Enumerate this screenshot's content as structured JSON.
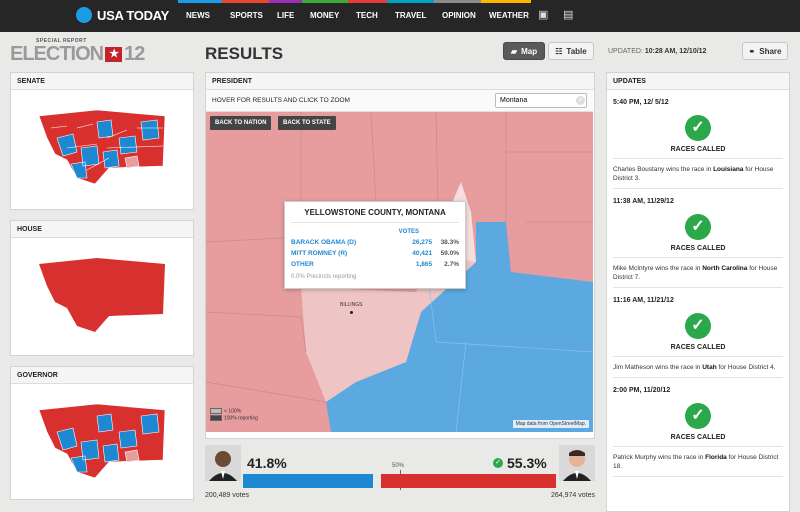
{
  "nav": {
    "logo": "USA TODAY",
    "items": [
      {
        "label": "NEWS",
        "color": "#1c9ce6"
      },
      {
        "label": "SPORTS",
        "color": "#e64a2e"
      },
      {
        "label": "LIFE",
        "color": "#9b2eb8"
      },
      {
        "label": "MONEY",
        "color": "#3cab3b"
      },
      {
        "label": "TECH",
        "color": "#e83a3a"
      },
      {
        "label": "TRAVEL",
        "color": "#00a3c4"
      },
      {
        "label": "OPINION",
        "color": "#8c8c8c"
      },
      {
        "label": "WEATHER",
        "color": "#ffb400"
      }
    ],
    "icons": [
      "media-icon",
      "weather-icon"
    ]
  },
  "header": {
    "special_report": "SPECIAL REPORT",
    "election": "ELECTION",
    "election_year": "12",
    "title": "RESULTS",
    "map_label": "Map",
    "table_label": "Table",
    "updated_label": "UPDATED:",
    "updated_value": "10:28 AM, 12/10/12",
    "share_label": "Share"
  },
  "left": {
    "senate": "SENATE",
    "house": "HOUSE",
    "governor": "GOVERNOR"
  },
  "president": {
    "title": "PRESIDENT",
    "hint": "HOVER FOR RESULTS AND CLICK TO ZOOM",
    "search_value": "Montana",
    "back_nation": "BACK TO NATION",
    "back_state": "BACK TO STATE",
    "popup": {
      "title": "YELLOWSTONE COUNTY, MONTANA",
      "votes_header": "VOTES",
      "rows": [
        {
          "name": "BARACK OBAMA (D)",
          "votes": "26,275",
          "pct": "38.3%"
        },
        {
          "name": "MITT ROMNEY (R)",
          "votes": "40,421",
          "pct": "59.0%"
        },
        {
          "name": "OTHER",
          "votes": "1,865",
          "pct": "2.7%"
        }
      ],
      "note": "0.0% Precincts reporting"
    },
    "city": "BILLINGS",
    "legend": [
      "< 100%",
      "100% reporting"
    ],
    "attribution": "Map data from OpenStreetMap."
  },
  "results": {
    "left_pct": "41.8%",
    "right_pct": "55.3%",
    "mid_label": "50%",
    "left_votes": "200,489 votes",
    "right_votes": "264,974 votes",
    "left_share": 41.8,
    "right_share": 55.3,
    "colors": {
      "dem": "#1e88d3",
      "rep": "#d8302e"
    }
  },
  "updates": {
    "title": "UPDATES",
    "items": [
      {
        "time": "5:40 PM, 12/ 5/12",
        "called": "RACES CALLED",
        "text_pre": "Charles Boustany wins the race in ",
        "state": "Louisiana",
        "text_post": " for House District 3."
      },
      {
        "time": "11:38 AM, 11/29/12",
        "called": "RACES CALLED",
        "text_pre": "Mike McIntyre wins the race in ",
        "state": "North Carolina",
        "text_post": " for House District 7."
      },
      {
        "time": "11:16 AM, 11/21/12",
        "called": "RACES CALLED",
        "text_pre": "Jim Matheson wins the race in ",
        "state": "Utah",
        "text_post": " for House District 4."
      },
      {
        "time": "2:00 PM, 11/20/12",
        "called": "RACES CALLED",
        "text_pre": "Patrick Murphy wins the race in ",
        "state": "Florida",
        "text_post": " for House District 18."
      }
    ]
  }
}
